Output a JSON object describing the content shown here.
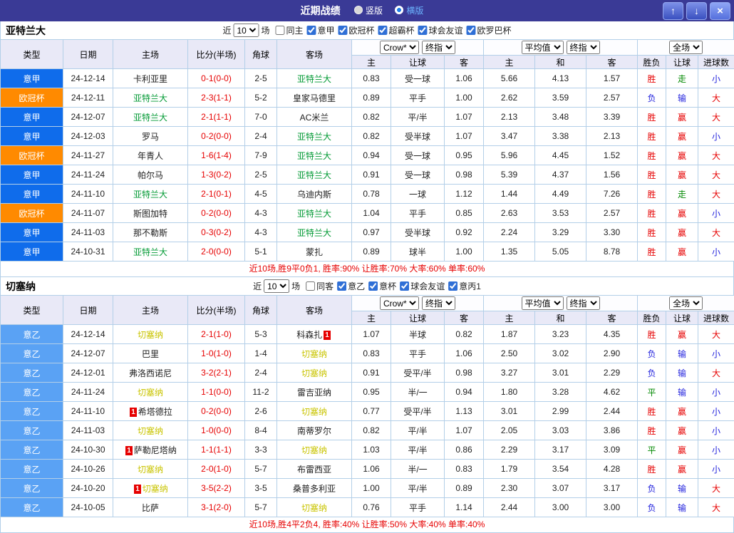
{
  "topbar": {
    "title": "近期战绩",
    "radios": [
      {
        "label": "竖版",
        "selected": false
      },
      {
        "label": "横版",
        "selected": true
      }
    ],
    "icons": {
      "up": "↑",
      "down": "↓",
      "close": "×"
    }
  },
  "header": {
    "col_type": "类型",
    "col_date": "日期",
    "col_home": "主场",
    "col_score": "比分(半场)",
    "col_corner": "角球",
    "col_away": "客场",
    "group1_select1": "Crow*",
    "group1_select2": "终指",
    "group2_select1": "平均值",
    "group2_select2": "终指",
    "group3_select1": "全场",
    "sub_home": "主",
    "sub_handicap": "让球",
    "sub_away": "客",
    "sub_avg_home": "主",
    "sub_draw": "和",
    "sub_avg_away": "客",
    "sub_result": "胜负",
    "sub_handicap_result": "让球",
    "sub_goals": "进球数"
  },
  "badges": {
    "red_card": "1"
  },
  "league_colors": {
    "意甲": "#0f6ceb",
    "欧冠杯": "#ff8a00",
    "意乙": "#5aa2f4"
  },
  "result_colors": {
    "胜": "#e60000",
    "负": "#2222dd",
    "平": "#008800",
    "赢": "#e60000",
    "输": "#2222dd",
    "走": "#008800",
    "大": "#e60000",
    "小": "#2222dd"
  },
  "sections": [
    {
      "title": "亚特兰大",
      "focus_color": "#009933",
      "filter": {
        "near_label": "近",
        "games": "10",
        "games_label": "场",
        "checkboxes": [
          {
            "label": "同主",
            "checked": false
          },
          {
            "label": "意甲",
            "checked": true
          },
          {
            "label": "欧冠杯",
            "checked": true
          },
          {
            "label": "超霸杯",
            "checked": true
          },
          {
            "label": "球会友谊",
            "checked": true
          },
          {
            "label": "欧罗巴杯",
            "checked": true
          }
        ]
      },
      "rows": [
        {
          "league": "意甲",
          "date": "24-12-14",
          "home": {
            "name": "卡利亚里",
            "focus": false,
            "card": ""
          },
          "score": "0-1(0-0)",
          "corner": "2-5",
          "away": {
            "name": "亚特兰大",
            "focus": true,
            "card": ""
          },
          "odds": [
            "0.83",
            "受一球",
            "1.06"
          ],
          "avg": [
            "5.66",
            "4.13",
            "1.57"
          ],
          "result": "胜",
          "let": "走",
          "goal": "小"
        },
        {
          "league": "欧冠杯",
          "date": "24-12-11",
          "home": {
            "name": "亚特兰大",
            "focus": true,
            "card": ""
          },
          "score": "2-3(1-1)",
          "corner": "5-2",
          "away": {
            "name": "皇家马德里",
            "focus": false,
            "card": ""
          },
          "odds": [
            "0.89",
            "平手",
            "1.00"
          ],
          "avg": [
            "2.62",
            "3.59",
            "2.57"
          ],
          "result": "负",
          "let": "输",
          "goal": "大"
        },
        {
          "league": "意甲",
          "date": "24-12-07",
          "home": {
            "name": "亚特兰大",
            "focus": true,
            "card": ""
          },
          "score": "2-1(1-1)",
          "corner": "7-0",
          "away": {
            "name": "AC米兰",
            "focus": false,
            "card": ""
          },
          "odds": [
            "0.82",
            "平/半",
            "1.07"
          ],
          "avg": [
            "2.13",
            "3.48",
            "3.39"
          ],
          "result": "胜",
          "let": "赢",
          "goal": "大"
        },
        {
          "league": "意甲",
          "date": "24-12-03",
          "home": {
            "name": "罗马",
            "focus": false,
            "card": ""
          },
          "score": "0-2(0-0)",
          "corner": "2-4",
          "away": {
            "name": "亚特兰大",
            "focus": true,
            "card": ""
          },
          "odds": [
            "0.82",
            "受半球",
            "1.07"
          ],
          "avg": [
            "3.47",
            "3.38",
            "2.13"
          ],
          "result": "胜",
          "let": "赢",
          "goal": "小"
        },
        {
          "league": "欧冠杯",
          "date": "24-11-27",
          "home": {
            "name": "年青人",
            "focus": false,
            "card": ""
          },
          "score": "1-6(1-4)",
          "corner": "7-9",
          "away": {
            "name": "亚特兰大",
            "focus": true,
            "card": ""
          },
          "odds": [
            "0.94",
            "受一球",
            "0.95"
          ],
          "avg": [
            "5.96",
            "4.45",
            "1.52"
          ],
          "result": "胜",
          "let": "赢",
          "goal": "大"
        },
        {
          "league": "意甲",
          "date": "24-11-24",
          "home": {
            "name": "帕尔马",
            "focus": false,
            "card": ""
          },
          "score": "1-3(0-2)",
          "corner": "2-5",
          "away": {
            "name": "亚特兰大",
            "focus": true,
            "card": ""
          },
          "odds": [
            "0.91",
            "受一球",
            "0.98"
          ],
          "avg": [
            "5.39",
            "4.37",
            "1.56"
          ],
          "result": "胜",
          "let": "赢",
          "goal": "大"
        },
        {
          "league": "意甲",
          "date": "24-11-10",
          "home": {
            "name": "亚特兰大",
            "focus": true,
            "card": ""
          },
          "score": "2-1(0-1)",
          "corner": "4-5",
          "away": {
            "name": "乌迪内斯",
            "focus": false,
            "card": ""
          },
          "odds": [
            "0.78",
            "一球",
            "1.12"
          ],
          "avg": [
            "1.44",
            "4.49",
            "7.26"
          ],
          "result": "胜",
          "let": "走",
          "goal": "大"
        },
        {
          "league": "欧冠杯",
          "date": "24-11-07",
          "home": {
            "name": "斯图加特",
            "focus": false,
            "card": ""
          },
          "score": "0-2(0-0)",
          "corner": "4-3",
          "away": {
            "name": "亚特兰大",
            "focus": true,
            "card": ""
          },
          "odds": [
            "1.04",
            "平手",
            "0.85"
          ],
          "avg": [
            "2.63",
            "3.53",
            "2.57"
          ],
          "result": "胜",
          "let": "赢",
          "goal": "小"
        },
        {
          "league": "意甲",
          "date": "24-11-03",
          "home": {
            "name": "那不勒斯",
            "focus": false,
            "card": ""
          },
          "score": "0-3(0-2)",
          "corner": "4-3",
          "away": {
            "name": "亚特兰大",
            "focus": true,
            "card": ""
          },
          "odds": [
            "0.97",
            "受半球",
            "0.92"
          ],
          "avg": [
            "2.24",
            "3.29",
            "3.30"
          ],
          "result": "胜",
          "let": "赢",
          "goal": "大"
        },
        {
          "league": "意甲",
          "date": "24-10-31",
          "home": {
            "name": "亚特兰大",
            "focus": true,
            "card": ""
          },
          "score": "2-0(0-0)",
          "corner": "5-1",
          "away": {
            "name": "蒙扎",
            "focus": false,
            "card": ""
          },
          "odds": [
            "0.89",
            "球半",
            "1.00"
          ],
          "avg": [
            "1.35",
            "5.05",
            "8.78"
          ],
          "result": "胜",
          "let": "赢",
          "goal": "小"
        }
      ],
      "summary": "近10场,胜9平0负1, 胜率:90% 让胜率:70% 大率:60% 单率:60%"
    },
    {
      "title": "切塞纳",
      "focus_color": "#c9c400",
      "filter": {
        "near_label": "近",
        "games": "10",
        "games_label": "场",
        "checkboxes": [
          {
            "label": "同客",
            "checked": false
          },
          {
            "label": "意乙",
            "checked": true
          },
          {
            "label": "意杯",
            "checked": true
          },
          {
            "label": "球会友谊",
            "checked": true
          },
          {
            "label": "意丙1",
            "checked": true
          }
        ]
      },
      "rows": [
        {
          "league": "意乙",
          "date": "24-12-14",
          "home": {
            "name": "切塞纳",
            "focus": true,
            "card": ""
          },
          "score": "2-1(1-0)",
          "corner": "5-3",
          "away": {
            "name": "科森扎",
            "focus": false,
            "card": "after"
          },
          "odds": [
            "1.07",
            "半球",
            "0.82"
          ],
          "avg": [
            "1.87",
            "3.23",
            "4.35"
          ],
          "result": "胜",
          "let": "赢",
          "goal": "大"
        },
        {
          "league": "意乙",
          "date": "24-12-07",
          "home": {
            "name": "巴里",
            "focus": false,
            "card": ""
          },
          "score": "1-0(1-0)",
          "corner": "1-4",
          "away": {
            "name": "切塞纳",
            "focus": true,
            "card": ""
          },
          "odds": [
            "0.83",
            "平手",
            "1.06"
          ],
          "avg": [
            "2.50",
            "3.02",
            "2.90"
          ],
          "result": "负",
          "let": "输",
          "goal": "小"
        },
        {
          "league": "意乙",
          "date": "24-12-01",
          "home": {
            "name": "弗洛西诺尼",
            "focus": false,
            "card": ""
          },
          "score": "3-2(2-1)",
          "corner": "2-4",
          "away": {
            "name": "切塞纳",
            "focus": true,
            "card": ""
          },
          "odds": [
            "0.91",
            "受平/半",
            "0.98"
          ],
          "avg": [
            "3.27",
            "3.01",
            "2.29"
          ],
          "result": "负",
          "let": "输",
          "goal": "大"
        },
        {
          "league": "意乙",
          "date": "24-11-24",
          "home": {
            "name": "切塞纳",
            "focus": true,
            "card": ""
          },
          "score": "1-1(0-0)",
          "corner": "11-2",
          "away": {
            "name": "雷吉亚纳",
            "focus": false,
            "card": ""
          },
          "odds": [
            "0.95",
            "半/一",
            "0.94"
          ],
          "avg": [
            "1.80",
            "3.28",
            "4.62"
          ],
          "result": "平",
          "let": "输",
          "goal": "小"
        },
        {
          "league": "意乙",
          "date": "24-11-10",
          "home": {
            "name": "希塔德拉",
            "focus": false,
            "card": "before"
          },
          "score": "0-2(0-0)",
          "corner": "2-6",
          "away": {
            "name": "切塞纳",
            "focus": true,
            "card": ""
          },
          "odds": [
            "0.77",
            "受平/半",
            "1.13"
          ],
          "avg": [
            "3.01",
            "2.99",
            "2.44"
          ],
          "result": "胜",
          "let": "赢",
          "goal": "小"
        },
        {
          "league": "意乙",
          "date": "24-11-03",
          "home": {
            "name": "切塞纳",
            "focus": true,
            "card": ""
          },
          "score": "1-0(0-0)",
          "corner": "8-4",
          "away": {
            "name": "南蒂罗尔",
            "focus": false,
            "card": ""
          },
          "odds": [
            "0.82",
            "平/半",
            "1.07"
          ],
          "avg": [
            "2.05",
            "3.03",
            "3.86"
          ],
          "result": "胜",
          "let": "赢",
          "goal": "小"
        },
        {
          "league": "意乙",
          "date": "24-10-30",
          "home": {
            "name": "萨勒尼塔纳",
            "focus": false,
            "card": "before"
          },
          "score": "1-1(1-1)",
          "corner": "3-3",
          "away": {
            "name": "切塞纳",
            "focus": true,
            "card": ""
          },
          "odds": [
            "1.03",
            "平/半",
            "0.86"
          ],
          "avg": [
            "2.29",
            "3.17",
            "3.09"
          ],
          "result": "平",
          "let": "赢",
          "goal": "小"
        },
        {
          "league": "意乙",
          "date": "24-10-26",
          "home": {
            "name": "切塞纳",
            "focus": true,
            "card": ""
          },
          "score": "2-0(1-0)",
          "corner": "5-7",
          "away": {
            "name": "布雷西亚",
            "focus": false,
            "card": ""
          },
          "odds": [
            "1.06",
            "半/一",
            "0.83"
          ],
          "avg": [
            "1.79",
            "3.54",
            "4.28"
          ],
          "result": "胜",
          "let": "赢",
          "goal": "小"
        },
        {
          "league": "意乙",
          "date": "24-10-20",
          "home": {
            "name": "切塞纳",
            "focus": true,
            "card": "before"
          },
          "score": "3-5(2-2)",
          "corner": "3-5",
          "away": {
            "name": "桑普多利亚",
            "focus": false,
            "card": ""
          },
          "odds": [
            "1.00",
            "平/半",
            "0.89"
          ],
          "avg": [
            "2.30",
            "3.07",
            "3.17"
          ],
          "result": "负",
          "let": "输",
          "goal": "大"
        },
        {
          "league": "意乙",
          "date": "24-10-05",
          "home": {
            "name": "比萨",
            "focus": false,
            "card": ""
          },
          "score": "3-1(2-0)",
          "corner": "5-7",
          "away": {
            "name": "切塞纳",
            "focus": true,
            "card": ""
          },
          "odds": [
            "0.76",
            "平手",
            "1.14"
          ],
          "avg": [
            "2.44",
            "3.00",
            "3.00"
          ],
          "result": "负",
          "let": "输",
          "goal": "大"
        }
      ],
      "summary": "近10场,胜4平2负4, 胜率:40% 让胜率:50% 大率:40% 单率:40%"
    }
  ]
}
